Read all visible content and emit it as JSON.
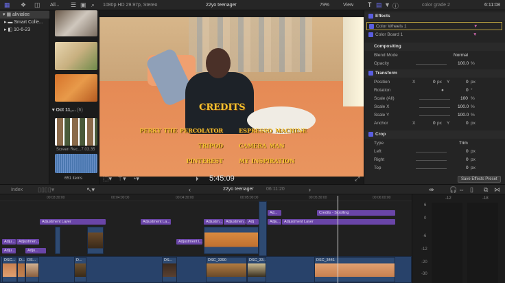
{
  "topbar": {
    "filter": "All...",
    "format": "1080p HD 29.97p, Stereo",
    "project": "22yo teenager",
    "zoom": "79%",
    "view": "View",
    "clip_name": "color grade 2",
    "duration": "6:11:08"
  },
  "library": {
    "items": [
      {
        "label": "alivialee"
      },
      {
        "label": "Smart Colle..."
      },
      {
        "label": "10-6-23"
      }
    ]
  },
  "browser": {
    "group": "Oct 11,...",
    "group_count": "(6)",
    "clip_label": "Screen Rec...7.03.35",
    "items_count": "651 items"
  },
  "viewer": {
    "credits": {
      "title": "Credits",
      "rows": [
        [
          "Perky the Percolator",
          "Espresso Machine"
        ],
        [
          "Tripod",
          "Camera Man"
        ],
        [
          "Pinterest",
          "My Inspiration"
        ]
      ]
    },
    "timecode": "5:45:09"
  },
  "inspector": {
    "effects": {
      "label": "Effects",
      "items": [
        "Color Wheels 1",
        "Color Board 1"
      ]
    },
    "compositing": {
      "label": "Compositing",
      "blend_label": "Blend Mode",
      "blend_value": "Normal",
      "opacity_label": "Opacity",
      "opacity_value": "100.0",
      "opacity_unit": "%"
    },
    "transform": {
      "label": "Transform",
      "position": "Position",
      "rotation": "Rotation",
      "rotation_value": "0",
      "rotation_unit": "°",
      "scale_all": "Scale (All)",
      "scale_all_value": "100",
      "scale_x": "Scale X",
      "scale_x_value": "100.0",
      "scale_y": "Scale Y",
      "scale_y_value": "100.0",
      "anchor": "Anchor",
      "x": "X",
      "y": "Y",
      "zero": "0",
      "px": "px",
      "pct": "%"
    },
    "crop": {
      "label": "Crop",
      "type_label": "Type",
      "type_value": "Trim",
      "left": "Left",
      "right": "Right",
      "top": "Top"
    },
    "save_preset": "Save Effects Preset"
  },
  "timeline": {
    "index": "Index",
    "project": "22yo teenager",
    "duration": "06:11:20",
    "ruler": [
      "00:03:30:00",
      "00:04:00:00",
      "00:04:30:00",
      "00:05:00:00",
      "00:05:30:00",
      "00:06:00:00"
    ],
    "adjust": [
      "Adjustment Layer",
      "Adjustment La...",
      "Adjustm...",
      "Adjustmen...",
      "Adj",
      "Adju...",
      "Adjustmen...",
      "Adju...",
      "Adju...",
      "Adjustment L...",
      "Ad...",
      "Adju...",
      "Adjustment Layer",
      "Credits - Scrolling"
    ],
    "clips": [
      "DSC...",
      "D...",
      "DS...",
      "D...",
      "DS...",
      "DSC_3390",
      "DSC_33...",
      "DSC_3441"
    ]
  },
  "meters": {
    "channels": [
      "-12",
      "-18"
    ],
    "scale": [
      "6",
      "0",
      "-6",
      "-12",
      "-20",
      "-30"
    ]
  }
}
